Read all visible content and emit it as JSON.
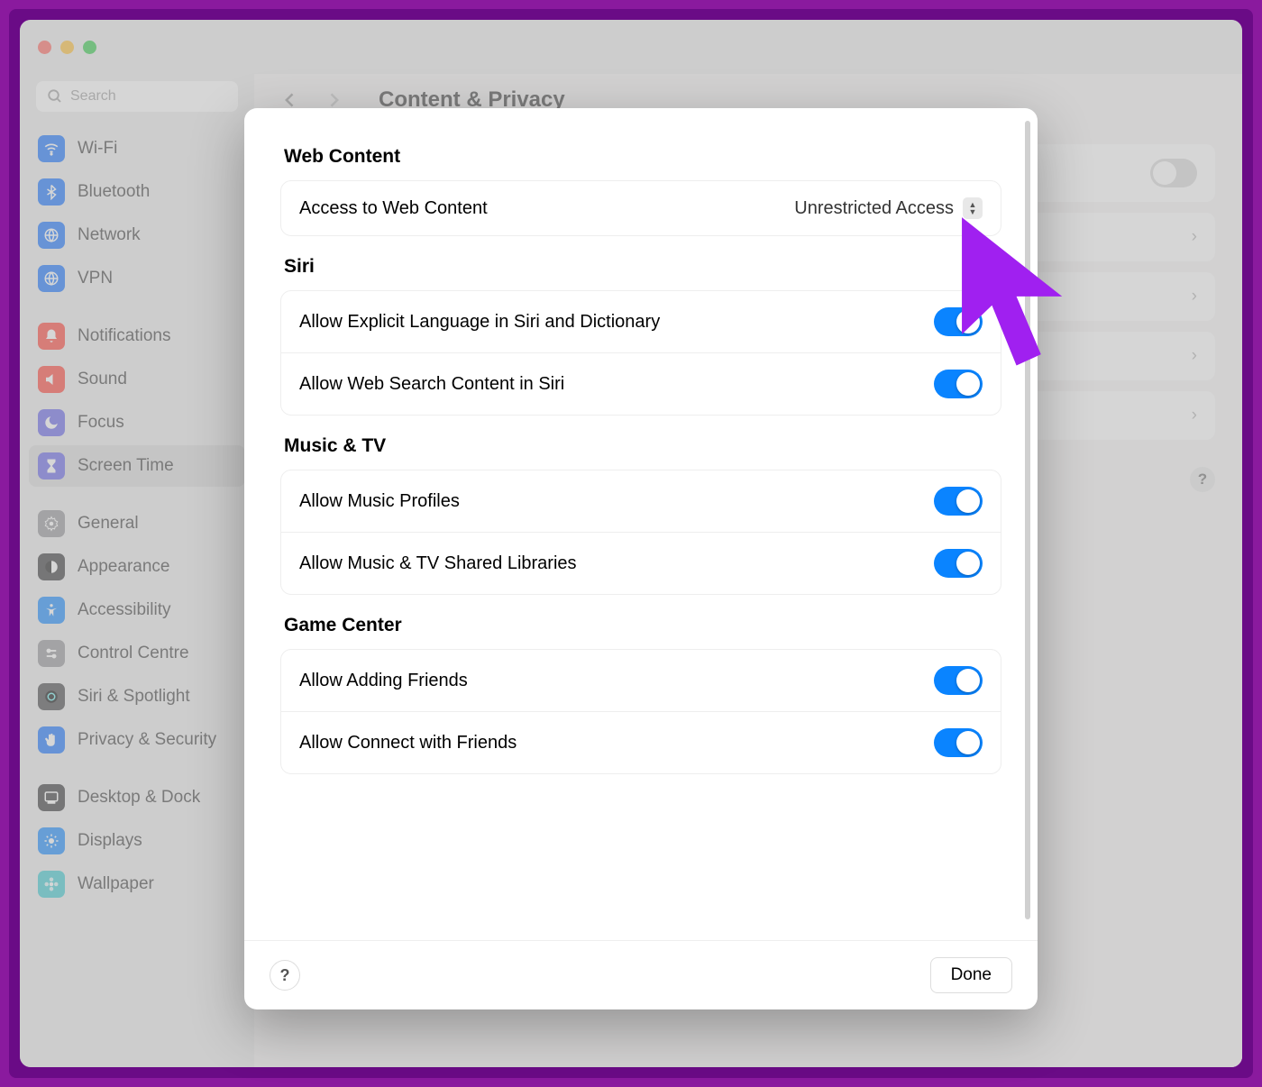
{
  "header": {
    "title": "Content & Privacy"
  },
  "search": {
    "placeholder": "Search"
  },
  "sidebar": {
    "group1": [
      {
        "label": "Wi-Fi",
        "color": "#0a6cff",
        "icon": "wifi"
      },
      {
        "label": "Bluetooth",
        "color": "#0a6cff",
        "icon": "bluetooth"
      },
      {
        "label": "Network",
        "color": "#0a6cff",
        "icon": "globe"
      },
      {
        "label": "VPN",
        "color": "#0a6cff",
        "icon": "globe"
      }
    ],
    "group2": [
      {
        "label": "Notifications",
        "color": "#ff3b30",
        "icon": "bell"
      },
      {
        "label": "Sound",
        "color": "#ff3b30",
        "icon": "speaker"
      },
      {
        "label": "Focus",
        "color": "#5e5ce6",
        "icon": "moon"
      },
      {
        "label": "Screen Time",
        "color": "#5e5ce6",
        "icon": "hourglass",
        "selected": true
      }
    ],
    "group3": [
      {
        "label": "General",
        "color": "#8e8e93",
        "icon": "gear"
      },
      {
        "label": "Appearance",
        "color": "#2c2c2e",
        "icon": "appearance"
      },
      {
        "label": "Accessibility",
        "color": "#0a84ff",
        "icon": "accessibility"
      },
      {
        "label": "Control Centre",
        "color": "#8e8e93",
        "icon": "switches"
      },
      {
        "label": "Siri & Spotlight",
        "color": "#3a3a3c",
        "icon": "siri"
      },
      {
        "label": "Privacy & Security",
        "color": "#0a6cff",
        "icon": "hand"
      }
    ],
    "group4": [
      {
        "label": "Desktop & Dock",
        "color": "#2c2c2e",
        "icon": "dock"
      },
      {
        "label": "Displays",
        "color": "#0a84ff",
        "icon": "sun"
      },
      {
        "label": "Wallpaper",
        "color": "#34c7ce",
        "icon": "flower"
      }
    ]
  },
  "modal": {
    "sections": [
      {
        "title": "Web Content",
        "rows": [
          {
            "label": "Access to Web Content",
            "kind": "select",
            "value": "Unrestricted Access"
          }
        ]
      },
      {
        "title": "Siri",
        "rows": [
          {
            "label": "Allow Explicit Language in Siri and Dictionary",
            "kind": "toggle",
            "on": true
          },
          {
            "label": "Allow Web Search Content in Siri",
            "kind": "toggle",
            "on": true
          }
        ]
      },
      {
        "title": "Music & TV",
        "rows": [
          {
            "label": "Allow Music Profiles",
            "kind": "toggle",
            "on": true
          },
          {
            "label": "Allow Music & TV Shared Libraries",
            "kind": "toggle",
            "on": true
          }
        ]
      },
      {
        "title": "Game Center",
        "rows": [
          {
            "label": "Allow Adding Friends",
            "kind": "toggle",
            "on": true
          },
          {
            "label": "Allow Connect with Friends",
            "kind": "toggle",
            "on": true
          }
        ]
      }
    ],
    "done": "Done",
    "help": "?"
  },
  "bg_help": "?"
}
